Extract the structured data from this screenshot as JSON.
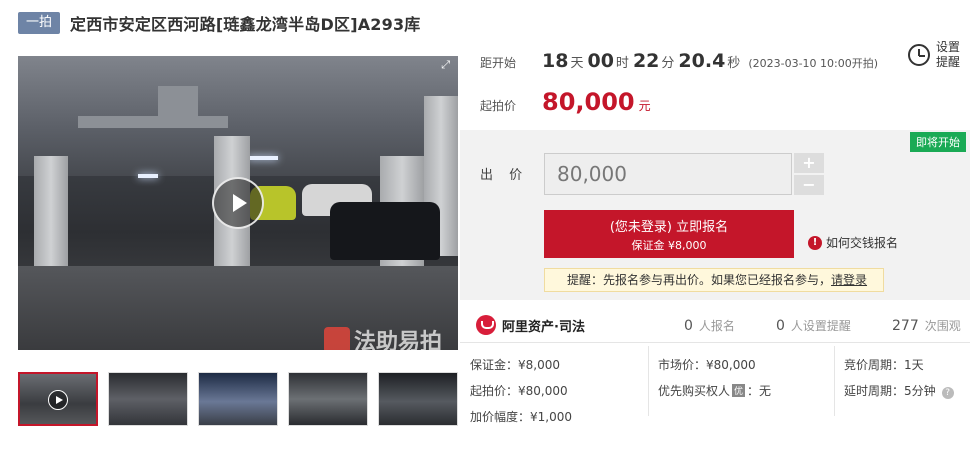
{
  "header": {
    "badge": "一拍",
    "title": "定西市安定区西河路[琏鑫龙湾半岛D区]A293库"
  },
  "media": {
    "watermark": "法助易拍",
    "expand_icon": "expand-icon",
    "thumb_count": 5
  },
  "countdown": {
    "label": "距开始",
    "days": "18",
    "days_unit": "天",
    "hours": "00",
    "hours_unit": "时",
    "minutes": "22",
    "minutes_unit": "分",
    "seconds": "20.4",
    "seconds_unit": "秒",
    "start_text": "(2023-03-10 10:00开拍)"
  },
  "reminder": {
    "label": "设置提醒",
    "icon": "alarm-clock-icon"
  },
  "start_price": {
    "label": "起拍价",
    "value": "80,000",
    "unit": "元"
  },
  "bid": {
    "status_tag": "即将开始",
    "label": "出 价",
    "input_value": "80,000",
    "plus": "+",
    "minus": "−",
    "signup_line1": "(您未登录) 立即报名",
    "signup_line2": "保证金 ¥8,000",
    "howto": "如何交钱报名",
    "notice_prefix": "提醒：先报名参与再出价。如果您已经报名参与，",
    "notice_login": "请登录"
  },
  "stats": {
    "brand": "阿里资产·司法",
    "signups": {
      "value": "0",
      "label": "人报名"
    },
    "reminders": {
      "value": "0",
      "label": "人设置提醒"
    },
    "views": {
      "value": "277",
      "label": "次围观"
    }
  },
  "details": {
    "deposit": "保证金：¥8,000",
    "start_price": "起拍价：¥80,000",
    "increment": "加价幅度：¥1,000",
    "market_price": "市场价：¥80,000",
    "priority_prefix": "优先购买权人",
    "priority_badge": "优",
    "priority_suffix": "：无",
    "cycle": "竞价周期：1天",
    "extension": "延时周期：5分钟"
  },
  "colors": {
    "accent": "#c4162a",
    "badge": "#6e84a6",
    "tag": "#1aaa55"
  }
}
